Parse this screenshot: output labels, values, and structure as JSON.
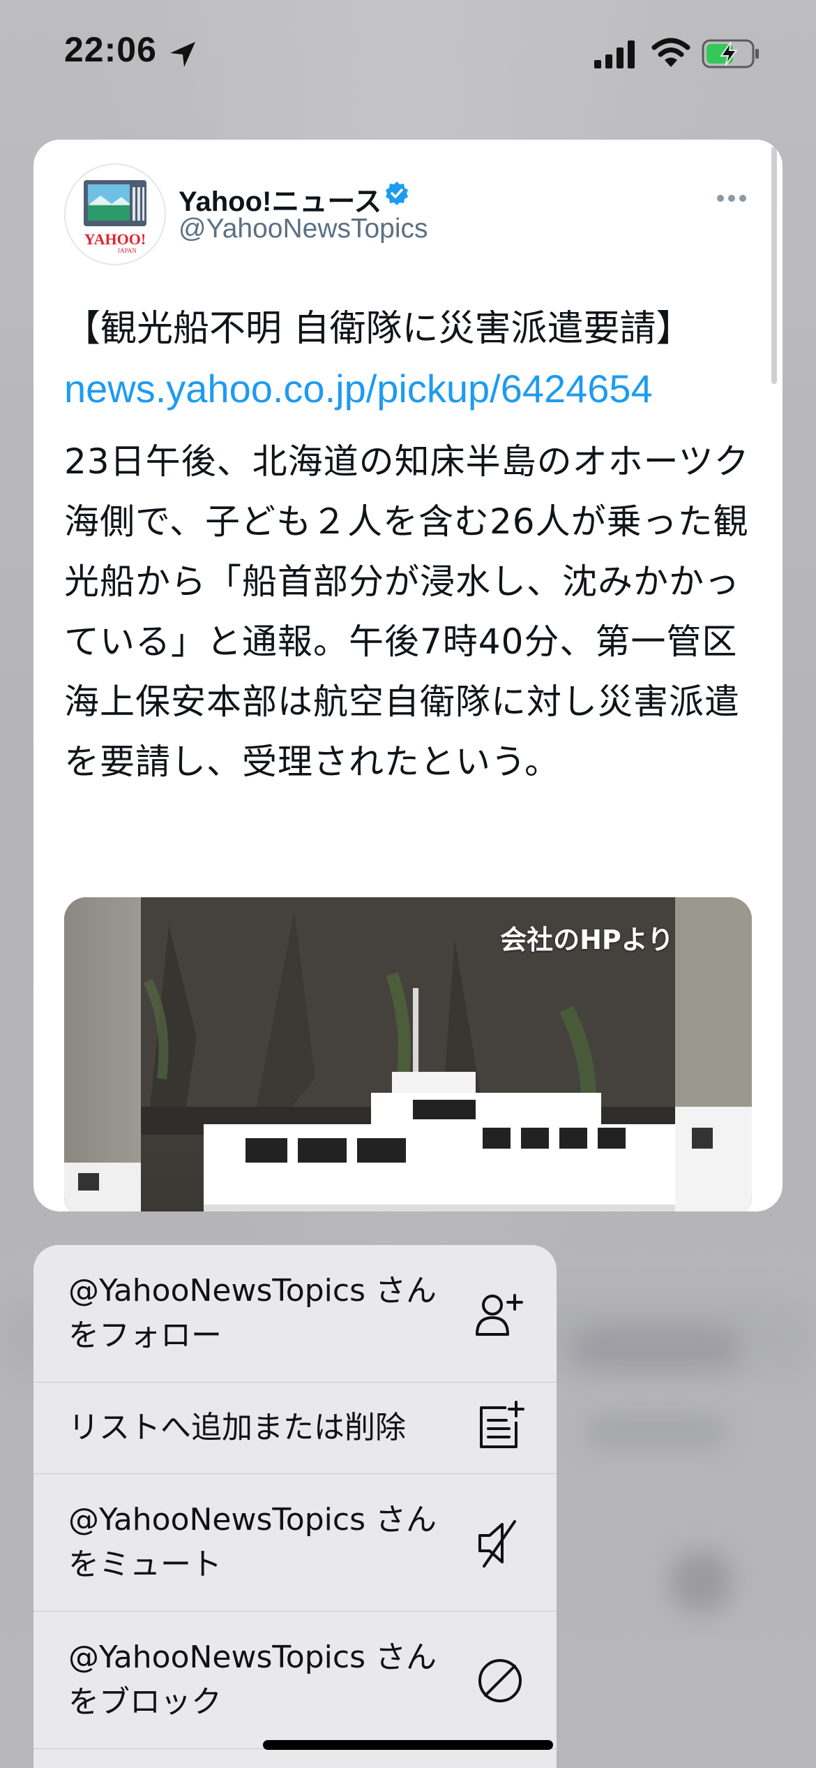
{
  "status_bar": {
    "time": "22:06"
  },
  "tweet": {
    "display_name": "Yahoo!ニュース",
    "handle": "@YahooNewsTopics",
    "headline": "【観光船不明 自衛隊に災害派遣要請】",
    "link": "news.yahoo.co.jp/pickup/6424654",
    "body": "23日午後、北海道の知床半島のオホーツク海側で、子ども２人を含む26人が乗った観光船から「船首部分が浸水し、沈みかかっている」と通報。午後7時40分、第一管区海上保安本部は航空自衛隊に対し災害派遣を要請し、受理されたという。",
    "media_caption": "会社のHPより",
    "avatar_text": "YAHOO!",
    "avatar_subtext": "JAPAN"
  },
  "menu": {
    "items": [
      {
        "label_line1": "@YahooNewsTopics さん",
        "label_line2": "をフォロー",
        "icon": "follow-user-icon"
      },
      {
        "label_line1": "リストへ追加または削除",
        "label_line2": "",
        "icon": "add-to-list-icon"
      },
      {
        "label_line1": "@YahooNewsTopics さん",
        "label_line2": "をミュート",
        "icon": "mute-icon"
      },
      {
        "label_line1": "@YahooNewsTopics さん",
        "label_line2": "をブロック",
        "icon": "block-icon"
      }
    ]
  },
  "colors": {
    "link": "#1d9bf0",
    "verified": "#1d9bf0",
    "battery_fill": "#34c759"
  }
}
